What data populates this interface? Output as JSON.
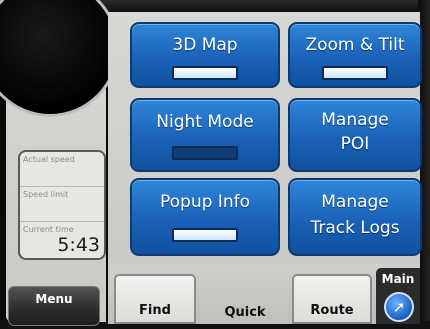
{
  "left_panel": {
    "info_rows": [
      {
        "label": "Actual speed",
        "value": ""
      },
      {
        "label": "Speed limit",
        "value": ""
      },
      {
        "label": "Current time",
        "value": "5:43"
      }
    ],
    "menu_label": "Menu"
  },
  "tiles": [
    {
      "label": "3D Map",
      "line2": "",
      "toggle": "on"
    },
    {
      "label": "Zoom & Tilt",
      "line2": "",
      "toggle": "on"
    },
    {
      "label": "Night Mode",
      "line2": "",
      "toggle": "off"
    },
    {
      "label": "Manage",
      "line2": "POI",
      "toggle": "none"
    },
    {
      "label": "Popup Info",
      "line2": "",
      "toggle": "on"
    },
    {
      "label": "Manage",
      "line2": "Track Logs",
      "toggle": "none"
    }
  ],
  "tabs": {
    "find": "Find",
    "quick": "Quick",
    "route": "Route",
    "main": "Main"
  },
  "icons": {
    "main": "compass-arrow-icon",
    "speedometer": "speedometer-dial"
  },
  "colors": {
    "tile_blue": "#1a62b8",
    "panel_gray": "#d2d3cf"
  }
}
